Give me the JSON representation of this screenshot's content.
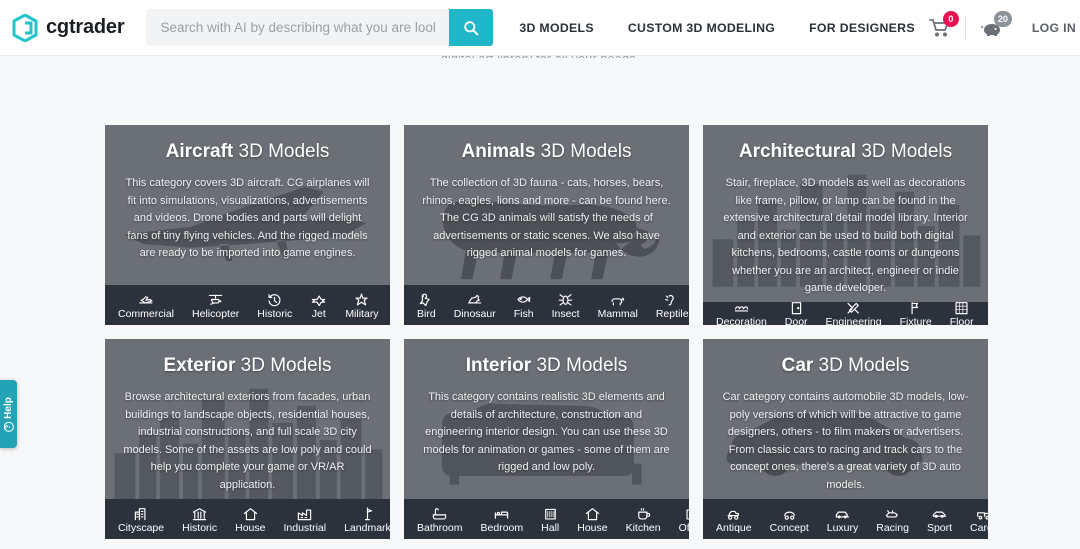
{
  "header": {
    "logo_text": "cgtrader",
    "logo_icon": "cgtrader-hex-logo",
    "search": {
      "placeholder": "Search with AI by describing what you are looking for",
      "value": "",
      "button_icon": "search-icon",
      "button_color": "#1fb6c9"
    },
    "nav": [
      {
        "label": "3D MODELS"
      },
      {
        "label": "CUSTOM 3D MODELING"
      },
      {
        "label": "FOR DESIGNERS"
      }
    ],
    "cart": {
      "icon": "shopping-cart-icon",
      "badge": "0",
      "badge_color": "#e5134f"
    },
    "coins": {
      "icon": "piggy-bank-icon",
      "badge": "20",
      "badge_color": "#8d9199"
    },
    "login_label": "LOG IN"
  },
  "ghost_text": "digital art library for all your needs.",
  "help_tab": {
    "label": "Help",
    "icon": "question-circle-icon",
    "color": "#23a3b5"
  },
  "cards": [
    {
      "title_bold": "Aircraft",
      "title_rest": " 3D Models",
      "bg_icon": "jet-silhouette",
      "description": "This category covers 3D aircraft. CG airplanes will fit into simulations, visualizations, advertisements and videos. Drone bodies and parts will delight fans of tiny flying vehicles. And the rigged models are ready to be imported into game engines.",
      "categories": [
        {
          "label": "Commercial",
          "icon": "commercial-plane-icon"
        },
        {
          "label": "Helicopter",
          "icon": "helicopter-icon"
        },
        {
          "label": "Historic",
          "icon": "clock-history-icon"
        },
        {
          "label": "Jet",
          "icon": "jet-icon"
        },
        {
          "label": "Military",
          "icon": "military-jet-icon"
        }
      ]
    },
    {
      "title_bold": "Animals",
      "title_rest": " 3D Models",
      "bg_icon": "panther-silhouette",
      "description": "The collection of 3D fauna - cats, horses, bears, rhinos, eagles, lions and more - can be found here. The CG 3D animals will satisfy the needs of advertisements or static scenes. We also have rigged animal models for games.",
      "categories": [
        {
          "label": "Bird",
          "icon": "bird-icon"
        },
        {
          "label": "Dinosaur",
          "icon": "dinosaur-icon"
        },
        {
          "label": "Fish",
          "icon": "fish-icon"
        },
        {
          "label": "Insect",
          "icon": "insect-icon"
        },
        {
          "label": "Mammal",
          "icon": "mammal-icon"
        },
        {
          "label": "Reptile",
          "icon": "reptile-icon"
        }
      ]
    },
    {
      "title_bold": "Architectural",
      "title_rest": " 3D Models",
      "bg_icon": "city-skyline-silhouette",
      "description": "Stair, fireplace, 3D models as well as decorations like frame, pillow, or lamp can be found in the extensive architectural detail model library. Interior and exterior can be used to build both digital kitchens, bedrooms, castle rooms or dungeons whether you are an architect, engineer or indie game developer.",
      "categories": [
        {
          "label": "Decoration",
          "icon": "decoration-icon"
        },
        {
          "label": "Door",
          "icon": "door-icon"
        },
        {
          "label": "Engineering",
          "icon": "tools-icon"
        },
        {
          "label": "Fixture",
          "icon": "fixture-icon"
        },
        {
          "label": "Floor",
          "icon": "floor-tile-icon"
        }
      ]
    },
    {
      "title_bold": "Exterior",
      "title_rest": " 3D Models",
      "bg_icon": "city-skyline-silhouette",
      "description": "Browse architectural exteriors from facades, urban buildings to landscape objects, residential houses, industrial constructions, and full scale 3D city models. Some of the assets are low poly and could help you complete your game or VR/AR application.",
      "categories": [
        {
          "label": "Cityscape",
          "icon": "cityscape-icon"
        },
        {
          "label": "Historic",
          "icon": "museum-icon"
        },
        {
          "label": "House",
          "icon": "home-icon"
        },
        {
          "label": "Industrial",
          "icon": "factory-icon"
        },
        {
          "label": "Landmark",
          "icon": "landmark-icon"
        }
      ]
    },
    {
      "title_bold": "Interior",
      "title_rest": " 3D Models",
      "bg_icon": "sofa-silhouette",
      "description": "This category contains realistic 3D elements and details of architecture, construction and engineering interior design. You can use these 3D models for animation or games - some of them are rigged and low poly.",
      "categories": [
        {
          "label": "Bathroom",
          "icon": "bathtub-icon"
        },
        {
          "label": "Bedroom",
          "icon": "bed-icon"
        },
        {
          "label": "Hall",
          "icon": "hall-icon"
        },
        {
          "label": "House",
          "icon": "home-icon"
        },
        {
          "label": "Kitchen",
          "icon": "cup-icon"
        },
        {
          "label": "Office",
          "icon": "office-icon"
        }
      ]
    },
    {
      "title_bold": "Car",
      "title_rest": " 3D Models",
      "bg_icon": "car-silhouette",
      "description": "Car category contains automobile 3D models, low-poly versions of which will be attractive to game designers, others - to film makers or advertisers. From classic cars to racing and track cars to the concept ones, there's a great variety of 3D auto models.",
      "categories": [
        {
          "label": "Antique",
          "icon": "antique-car-icon"
        },
        {
          "label": "Concept",
          "icon": "concept-car-icon"
        },
        {
          "label": "Luxury",
          "icon": "luxury-car-icon"
        },
        {
          "label": "Racing",
          "icon": "racing-car-icon"
        },
        {
          "label": "Sport",
          "icon": "sport-car-icon"
        },
        {
          "label": "Cargo",
          "icon": "cargo-car-icon"
        }
      ]
    }
  ]
}
